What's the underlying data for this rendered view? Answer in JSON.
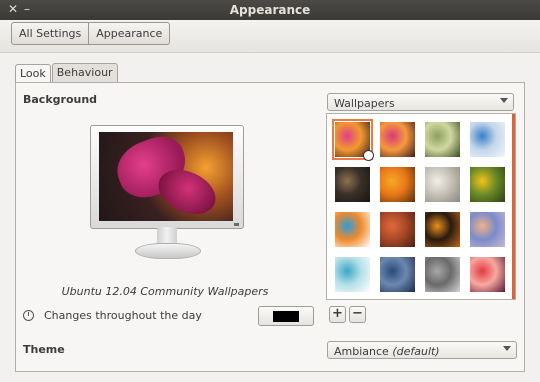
{
  "window": {
    "title": "Appearance"
  },
  "toolbar": {
    "all_settings": "All Settings",
    "appearance": "Appearance"
  },
  "tabs": [
    {
      "label": "Look"
    },
    {
      "label": "Behaviour"
    }
  ],
  "background": {
    "heading": "Background",
    "source": "Wallpapers",
    "caption": "Ubuntu 12.04 Community Wallpapers",
    "changes_label": "Changes throughout the day",
    "color": "#000000",
    "add_label": "+",
    "remove_label": "−"
  },
  "theme": {
    "heading": "Theme",
    "value": "Ambiance",
    "value_suffix": "(default)"
  },
  "wallpapers": [
    {
      "name": "flower-pink-orange",
      "selected": true,
      "colors": [
        "#e23d85",
        "#f29a2e",
        "#3a1a22"
      ]
    },
    {
      "name": "flower-pink-dark",
      "selected": false,
      "colors": [
        "#d83b7c",
        "#f59a3c",
        "#401a20"
      ]
    },
    {
      "name": "green-leaves",
      "selected": false,
      "colors": [
        "#8fa060",
        "#d0d8a0",
        "#3a4a20"
      ]
    },
    {
      "name": "blue-sky-flowers",
      "selected": false,
      "colors": [
        "#3a7ec9",
        "#c3d6ea",
        "#f2f6fa"
      ]
    },
    {
      "name": "dark-bokeh",
      "selected": false,
      "colors": [
        "#8c7250",
        "#3a3028",
        "#181410"
      ]
    },
    {
      "name": "orange-flower",
      "selected": false,
      "colors": [
        "#f9a826",
        "#e87818",
        "#5a3008"
      ]
    },
    {
      "name": "white-flower",
      "selected": false,
      "colors": [
        "#f2eee6",
        "#c7c2b6",
        "#8a8680"
      ]
    },
    {
      "name": "yellow-flowers-green",
      "selected": false,
      "colors": [
        "#f2c418",
        "#6c8a28",
        "#2a4010"
      ]
    },
    {
      "name": "blue-orange-cartoon",
      "selected": false,
      "colors": [
        "#2f9bd8",
        "#f08a2c",
        "#ffffff"
      ]
    },
    {
      "name": "red-origami",
      "selected": false,
      "colors": [
        "#e06a3a",
        "#a84828",
        "#4a2010"
      ]
    },
    {
      "name": "orange-ring",
      "selected": false,
      "colors": [
        "#e8901c",
        "#2a1a10",
        "#c06818"
      ]
    },
    {
      "name": "sunset-clouds",
      "selected": false,
      "colors": [
        "#f2b08c",
        "#7a8cc8",
        "#c8b8d4"
      ]
    },
    {
      "name": "teal-paper",
      "selected": false,
      "colors": [
        "#3aa6c6",
        "#b4e0e8",
        "#ffffff"
      ]
    },
    {
      "name": "blue-texture",
      "selected": false,
      "colors": [
        "#2a4a78",
        "#6c88b0",
        "#1a2a48"
      ]
    },
    {
      "name": "grey-stone",
      "selected": false,
      "colors": [
        "#a8a8a8",
        "#6a6a6a",
        "#d4d4d4"
      ]
    },
    {
      "name": "red-bokeh",
      "selected": false,
      "colors": [
        "#e23a42",
        "#f8a8a0",
        "#5a1a30"
      ]
    }
  ],
  "icons": {
    "close": "close-icon",
    "minimize": "minimize-icon",
    "clock": "clock-icon"
  }
}
